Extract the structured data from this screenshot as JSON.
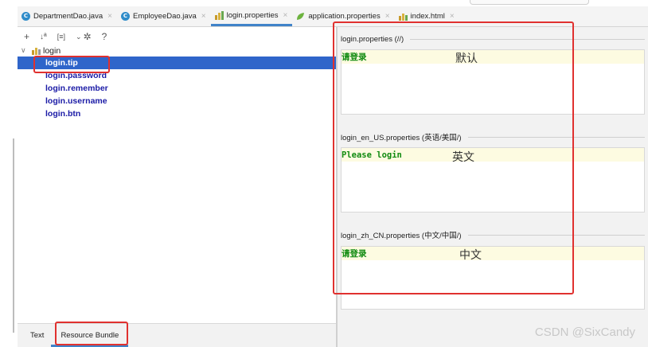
{
  "tabs": [
    {
      "label": "DepartmentDao.java",
      "icon": "java-class-icon"
    },
    {
      "label": "EmployeeDao.java",
      "icon": "java-class-icon"
    },
    {
      "label": "login.properties",
      "icon": "resource-bundle-icon",
      "active": true
    },
    {
      "label": "application.properties",
      "icon": "spring-properties-icon"
    },
    {
      "label": "index.html",
      "icon": "html-file-icon"
    }
  ],
  "tab_close_glyph": "×",
  "toolbar": {
    "add": "+",
    "sort": "↓ª",
    "group": "[≡]",
    "separator": "⌄",
    "settings": "✲",
    "help": "?"
  },
  "tree": {
    "root_label": "login",
    "items": [
      "login.tip",
      "login.password",
      "login.remember",
      "login.username",
      "login.btn"
    ]
  },
  "bottom_tabs": [
    "Text",
    "Resource Bundle"
  ],
  "sections": [
    {
      "title": "login.properties (//)",
      "value": "请登录",
      "note": "默认"
    },
    {
      "title": "login_en_US.properties (英语/美国/)",
      "value": "Please login",
      "note": "英文"
    },
    {
      "title": "login_zh_CN.properties (中文/中国/)",
      "value": "请登录",
      "note": "中文"
    }
  ],
  "watermark": "CSDN @SixCandy",
  "colors": {
    "selection": "#2f65ca",
    "key_text": "#1a1aa6",
    "value_text": "#0f8a0f",
    "annotation_red": "#e0312f",
    "active_tab_underline": "#4083c9"
  }
}
